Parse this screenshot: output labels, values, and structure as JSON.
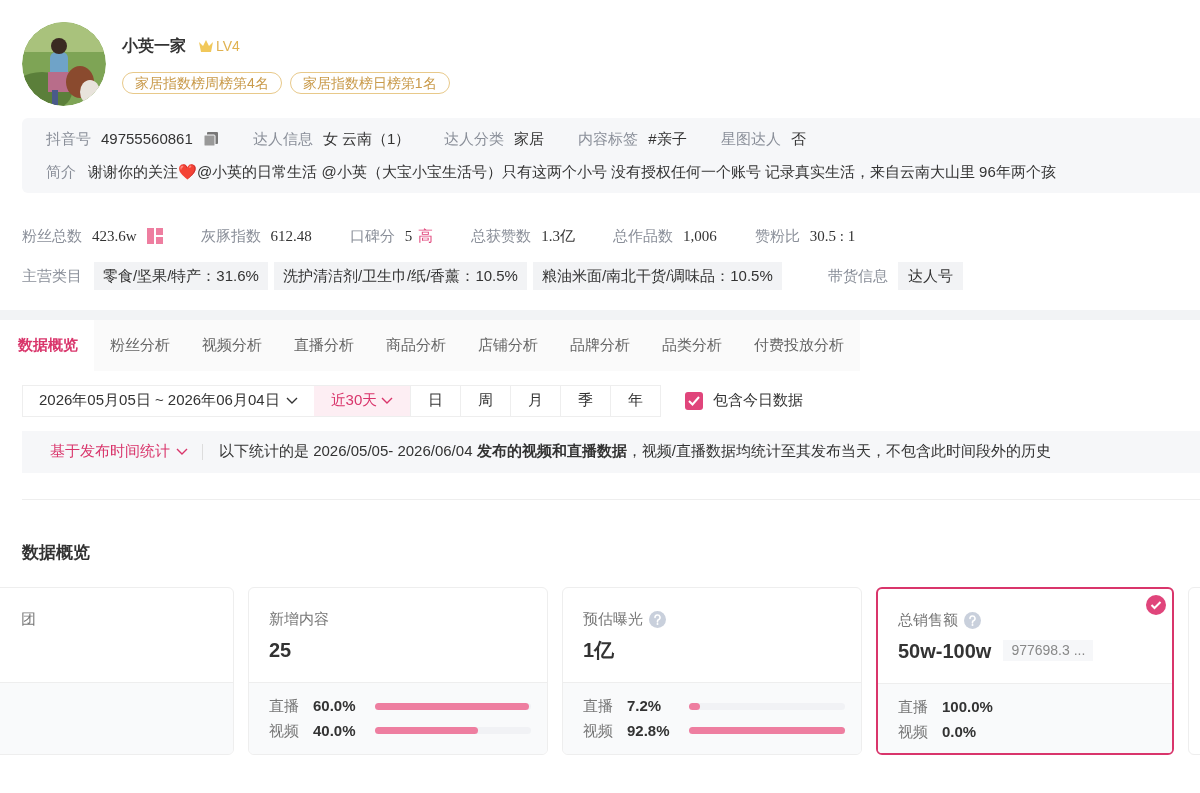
{
  "profile": {
    "name": "小英一家",
    "level": "LV4",
    "badges": [
      "家居指数榜周榜第4名",
      "家居指数榜日榜第1名"
    ]
  },
  "info": [
    {
      "label": "抖音号",
      "value": "49755560861",
      "copy": true
    },
    {
      "label": "达人信息",
      "value": "女 云南（1）",
      "copy": false
    },
    {
      "label": "达人分类",
      "value": "家居",
      "copy": false
    },
    {
      "label": "内容标签",
      "value": "#亲子",
      "copy": false
    },
    {
      "label": "星图达人",
      "value": "否",
      "copy": false
    }
  ],
  "bio": {
    "label": "简介",
    "text": "谢谢你的关注❤️@小英的日常生活 @小英（大宝小宝生活号）只有这两个小号 没有授权任何一个账号 记录真实生活，来自云南大山里 96年两个孩"
  },
  "stats": [
    {
      "label": "粉丝总数",
      "value": "423.6w",
      "icon": true
    },
    {
      "label": "灰豚指数",
      "value": "612.48",
      "icon": false
    },
    {
      "label": "口碑分",
      "value": "5",
      "tag": "高",
      "icon": false
    },
    {
      "label": "总获赞数",
      "value": "1.3亿",
      "icon": false
    },
    {
      "label": "总作品数",
      "value": "1,006",
      "icon": false
    },
    {
      "label": "赞粉比",
      "value": "30.5 : 1",
      "icon": false
    }
  ],
  "categories": {
    "label": "主营类目",
    "items": [
      "零食/坚果/特产：31.6%",
      "洗护清洁剂/卫生巾/纸/香薰：10.5%",
      "粮油米面/南北干货/调味品：10.5%"
    ],
    "sales_label": "带货信息",
    "sales_value": "达人号"
  },
  "tabs": [
    {
      "label": "数据概览",
      "selected": true
    },
    {
      "label": "粉丝分析",
      "selected": false
    },
    {
      "label": "视频分析",
      "selected": false
    },
    {
      "label": "直播分析",
      "selected": false
    },
    {
      "label": "商品分析",
      "selected": false
    },
    {
      "label": "店铺分析",
      "selected": false
    },
    {
      "label": "品牌分析",
      "selected": false
    },
    {
      "label": "品类分析",
      "selected": false
    },
    {
      "label": "付费投放分析",
      "selected": false
    }
  ],
  "filter": {
    "date_range": "2026年05月05日 ~ 2026年06月04日",
    "periods": [
      {
        "label": "近30天",
        "selected": true
      },
      {
        "label": "日",
        "selected": false
      },
      {
        "label": "周",
        "selected": false
      },
      {
        "label": "月",
        "selected": false
      },
      {
        "label": "季",
        "selected": false
      },
      {
        "label": "年",
        "selected": false
      }
    ],
    "include_today": {
      "label": "包含今日数据",
      "checked": true
    }
  },
  "notice": {
    "mode": "基于发布时间统计",
    "text": "以下统计的是 2026/05/05- 2026/06/04 **发布的视频和直播数据**，视频/直播数据均统计至其发布当天，不包含此时间段外的历史"
  },
  "section_title": "数据概览",
  "cards": [
    {
      "title": "团",
      "help": false,
      "selected": false
    },
    {
      "title": "新增内容",
      "help": false,
      "value": "25",
      "selected": false,
      "rows": [
        {
          "label": "直播",
          "pct": "60.0%",
          "level": 0.99
        },
        {
          "label": "视频",
          "pct": "40.0%",
          "level": 0.66
        }
      ]
    },
    {
      "title": "预估曝光",
      "help": true,
      "value": "1亿",
      "selected": false,
      "rows": [
        {
          "label": "直播",
          "pct": "7.2%",
          "level": 0.07
        },
        {
          "label": "视频",
          "pct": "92.8%",
          "level": 1
        }
      ]
    },
    {
      "title": "总销售额",
      "help": true,
      "value": "50w-100w",
      "extra": "977698.3 ...",
      "selected": true,
      "rows": [
        {
          "label": "直播",
          "pct": "100.0%"
        },
        {
          "label": "视频",
          "pct": "0.0%"
        }
      ]
    }
  ]
}
